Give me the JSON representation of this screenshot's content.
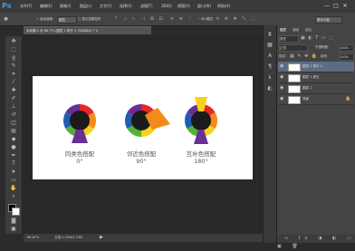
{
  "app": {
    "logo": "Ps"
  },
  "menu": [
    "文件(F)",
    "编辑(E)",
    "图像(I)",
    "图层(L)",
    "文字(Y)",
    "选择(S)",
    "滤镜(T)",
    "3D(D)",
    "视图(V)",
    "窗口(W)",
    "帮助(H)"
  ],
  "window_controls": [
    "—",
    "□",
    "✕"
  ],
  "options": {
    "auto_select_label": "✓ 自动选择:",
    "auto_select_value": "图层",
    "show_transform_label": "□ 显示变换控件",
    "mode3d_label": "3D 模式:",
    "workspace_value": "基本功能"
  },
  "document": {
    "tab_label": "未标题-1 @ 66.7% (图层 1 拷贝 2, RGB/8#) *  ×"
  },
  "wheels": [
    {
      "line1": "同类色搭配",
      "line2": "0°"
    },
    {
      "line1": "邻近色搭配",
      "line2": "90°"
    },
    {
      "line1": "互补色搭配",
      "line2": "180°"
    }
  ],
  "colors": {
    "canvas_bg": "#ffffff",
    "wheel_red": "#e8262a",
    "wheel_orange": "#f28a1c",
    "wheel_yellow": "#f7d21a",
    "wheel_green": "#55b135",
    "wheel_blue": "#1f5fb3",
    "wheel_purple": "#6a2f96",
    "accent_blue": "#30a0ff"
  },
  "status": {
    "zoom": "66.67%",
    "doc_size": "文档:1.32M/3.15M"
  },
  "panels": {
    "tabs": [
      "图层",
      "通道",
      "路径"
    ],
    "filter_kind": "类型",
    "blend_mode": "正常",
    "opacity_label": "不透明度:",
    "opacity_value": "100%",
    "lock_label": "锁定:",
    "fill_label": "填充:",
    "fill_value": "100%",
    "layers": [
      {
        "name": "图层 1 拷贝 2"
      },
      {
        "name": "图层 1 拷贝"
      },
      {
        "name": "图层 1"
      },
      {
        "name": "背景"
      }
    ]
  }
}
